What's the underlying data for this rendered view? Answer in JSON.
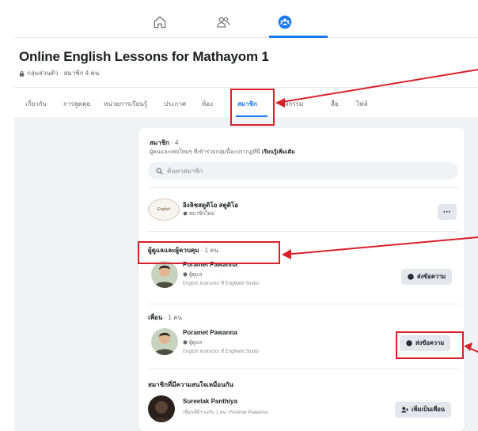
{
  "group": {
    "title": "Online English Lessons for Mathayom 1",
    "meta": "กลุ่มส่วนตัว · สมาชิก 4 คน"
  },
  "tabs": [
    {
      "label": "เกี่ยวกับ"
    },
    {
      "label": "การพูดคุย"
    },
    {
      "label": "หน่วยการเรียนรู้"
    },
    {
      "label": "ประกาศ"
    },
    {
      "label": "ห้อง"
    },
    {
      "label": "สมาชิก"
    },
    {
      "label": "กิจกรรม"
    },
    {
      "label": "สื่อ"
    },
    {
      "label": "ไฟล์"
    }
  ],
  "members": {
    "title": "สมาชิก",
    "count": "· 4",
    "description": "ผู้คนและเพจใหม่ๆ ที่เข้าร่วมกลุ่มนี้จะปรากฏที่นี่",
    "description_link": "เรียนรู้เพิ่มเติม",
    "search_placeholder": "ค้นหาสมาชิก"
  },
  "page_member": {
    "name": "อิงลิชสตูดิโอ สตูดิโอ",
    "role": "สมาชิกใหม่",
    "logo_text": "English",
    "more_label": "···"
  },
  "admins": {
    "title": "ผู้ดูแลและผู้ควบคุม",
    "count": "· 1 คน",
    "name": "Poramet Pawanna",
    "role": "ผู้ดูแล",
    "bio": "English Instructor ที่ EngMahi Studio",
    "button": "ส่งข้อความ"
  },
  "friends": {
    "title": "เพื่อน",
    "count": "· 1 คน",
    "name": "Poramet Pawanna",
    "role": "ผู้ดูแล",
    "bio": "English Instructor ที่ EngMahi Studio",
    "button": "ส่งข้อความ"
  },
  "similar": {
    "title": "สมาชิกที่มีความสนใจเหมือนกัน",
    "name": "Sureelak Panthiya",
    "sub": "เพื่อนที่มีร่วมกัน 1 คน: Poramet Pawanna",
    "button": "เพิ่มเป็นเพื่อน"
  },
  "colors": {
    "accent": "#1877f2",
    "annotation": "#d8202a",
    "background": "#f0f2f5"
  }
}
